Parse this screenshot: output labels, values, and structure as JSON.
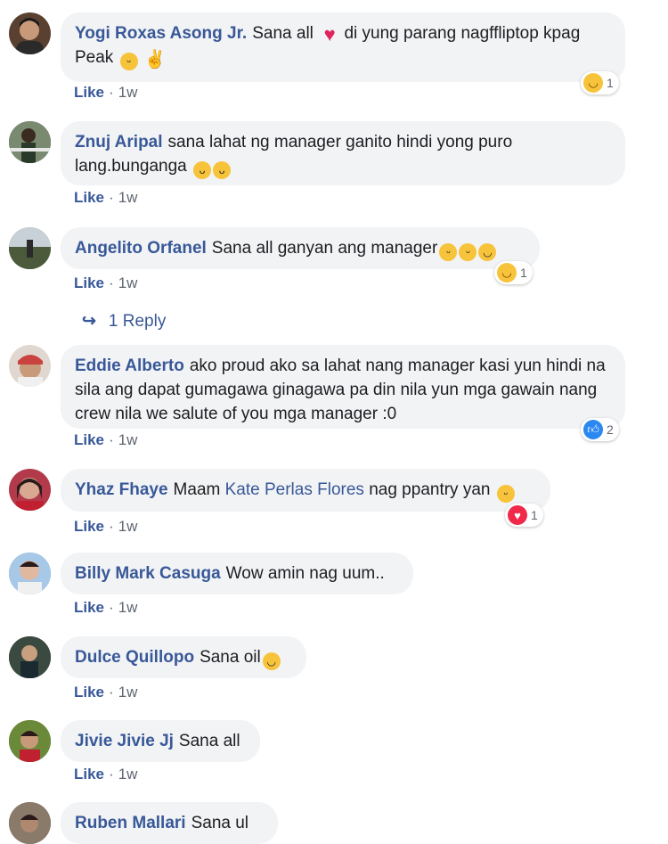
{
  "comments": [
    {
      "author": "Yogi Roxas Asong Jr.",
      "text_before": "Sana all",
      "text_after": "di yung parang nagffliptop kpag Peak",
      "time": "1w",
      "reaction_count": "1",
      "avatar_color": "#5a4030"
    },
    {
      "author": "Znuj Aripal",
      "text": "sana lahat ng manager ganito hindi yong puro lang.bunganga",
      "time": "1w",
      "avatar_color": "#3d4a3a"
    },
    {
      "author": "Angelito Orfanel",
      "text": "Sana all ganyan ang manager",
      "time": "1w",
      "reaction_count": "1",
      "avatar_color": "#6b7a5a"
    },
    {
      "author": "Eddie Alberto",
      "text": "ako proud ako sa lahat nang manager kasi yun hindi na sila ang dapat gumagawa ginagawa pa din nila yun mga gawain nang crew nila we salute of you mga manager :0",
      "time": "1w",
      "reaction_count": "2",
      "avatar_color": "#c9433f"
    },
    {
      "author": "Yhaz Fhaye",
      "text_before": "Maam",
      "mention": "Kate Perlas Flores",
      "text_after": "nag ppantry yan",
      "time": "1w",
      "reaction_count": "1",
      "avatar_color": "#b23a4a"
    },
    {
      "author": "Billy Mark Casuga",
      "text": "Wow amin nag uum..",
      "time": "1w",
      "avatar_color": "#4a7fb8"
    },
    {
      "author": "Dulce Quillopo",
      "text": "Sana oil",
      "time": "1w",
      "avatar_color": "#2f3f4a"
    },
    {
      "author": "Jivie Jivie Jj",
      "text": "Sana all",
      "time": "1w",
      "avatar_color": "#4a6a2a"
    },
    {
      "author": "Ruben Mallari",
      "text": "Sana ul",
      "avatar_color": "#5a4a3a"
    }
  ],
  "like_label": "Like",
  "reply_link": "1 Reply",
  "colors": {
    "link": "#385898",
    "bubble": "#f2f3f5"
  }
}
